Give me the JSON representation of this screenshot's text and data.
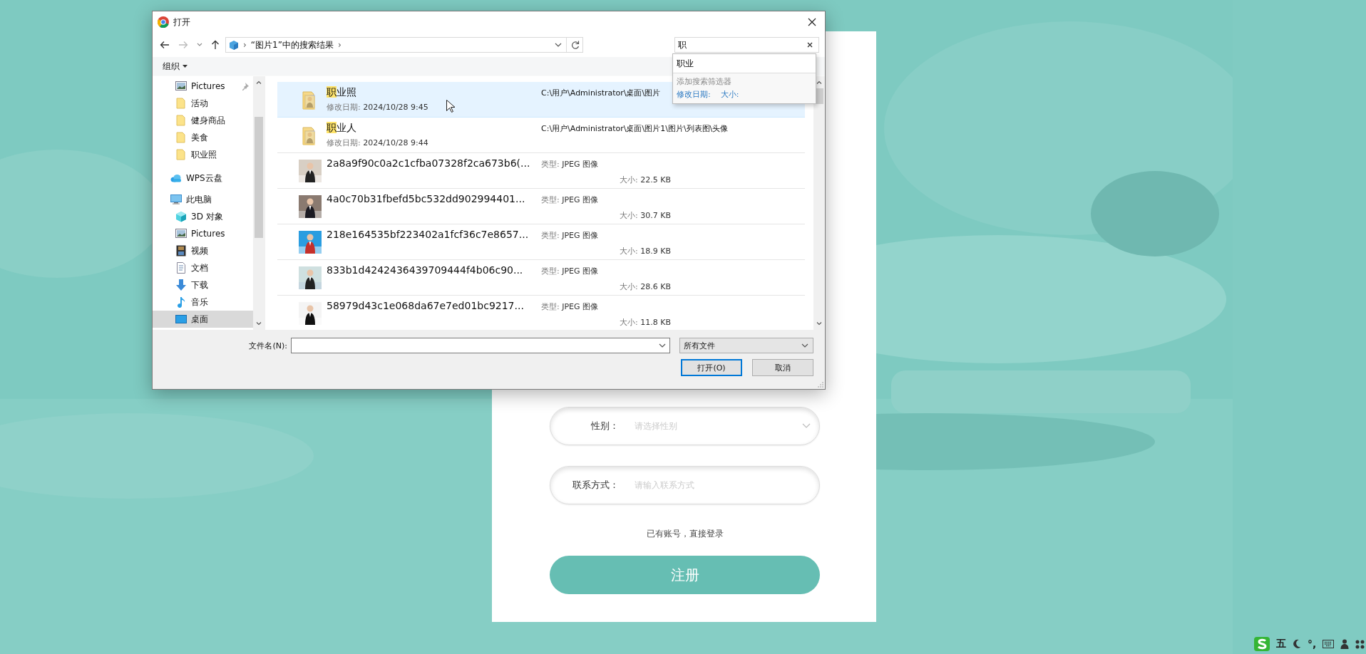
{
  "dialog": {
    "title": "打开",
    "address": [
      {
        "kind": "separator",
        "text": "›"
      },
      {
        "kind": "crumb",
        "text": "“图片1”中的搜索结果"
      },
      {
        "kind": "separator",
        "text": "›"
      }
    ],
    "search": {
      "value": "职"
    },
    "suggestions": {
      "items": [
        "职业"
      ],
      "filter_heading": "添加搜索筛选器",
      "filters": [
        "修改日期:",
        "大小:"
      ]
    },
    "toolbar": {
      "organize": "组织"
    },
    "nav_pane": {
      "quick_access": [
        {
          "label": "Pictures",
          "kind": "pictures",
          "pinned": true,
          "selected": false
        },
        {
          "label": "活动",
          "kind": "folder",
          "pinned": false,
          "selected": false
        },
        {
          "label": "健身商品",
          "kind": "folder",
          "pinned": false,
          "selected": false
        },
        {
          "label": "美食",
          "kind": "folder",
          "pinned": false,
          "selected": false
        },
        {
          "label": "职业照",
          "kind": "folder",
          "pinned": false,
          "selected": false
        }
      ],
      "items": [
        {
          "label": "WPS云盘",
          "kind": "cloud",
          "selected": false
        },
        {
          "label": "此电脑",
          "kind": "pc",
          "selected": false,
          "children": [
            {
              "label": "3D 对象",
              "kind": "cube",
              "selected": false
            },
            {
              "label": "Pictures",
              "kind": "pictures",
              "selected": false
            },
            {
              "label": "视频",
              "kind": "video",
              "selected": false
            },
            {
              "label": "文档",
              "kind": "document",
              "selected": false
            },
            {
              "label": "下载",
              "kind": "download",
              "selected": false
            },
            {
              "label": "音乐",
              "kind": "music",
              "selected": false
            },
            {
              "label": "桌面",
              "kind": "desktop",
              "selected": true
            }
          ]
        }
      ]
    },
    "results": [
      {
        "kind": "folder",
        "selected": true,
        "name_parts": [
          {
            "text": "职",
            "highlighted": true
          },
          {
            "text": "业照",
            "highlighted": false
          }
        ],
        "date_label": "修改日期:",
        "date": "2024/10/28 9:45",
        "path": "C:\\用户\\Administrator\\桌面\\图片"
      },
      {
        "kind": "folder",
        "selected": false,
        "name_parts": [
          {
            "text": "职",
            "highlighted": true
          },
          {
            "text": "业人",
            "highlighted": false
          }
        ],
        "date_label": "修改日期:",
        "date": "2024/10/28 9:44",
        "path": "C:\\用户\\Administrator\\桌面\\图片1\\图片\\列表图\\头像"
      },
      {
        "selected": false,
        "name": "2a8a9f90c0a2c1cfba07328f2ca673b6(...",
        "type_label": "类型:",
        "type": "JPEG 图像",
        "size_label": "大小:",
        "size": "22.5 KB"
      },
      {
        "selected": false,
        "name": "4a0c70b31fbefd5bc532dd902994401...",
        "type_label": "类型:",
        "type": "JPEG 图像",
        "size_label": "大小:",
        "size": "30.7 KB"
      },
      {
        "selected": false,
        "name": "218e164535bf223402a1fcf36c7e8657...",
        "type_label": "类型:",
        "type": "JPEG 图像",
        "size_label": "大小:",
        "size": "18.9 KB"
      },
      {
        "selected": false,
        "name": "833b1d4242436439709444f4b06c90...",
        "type_label": "类型:",
        "type": "JPEG 图像",
        "size_label": "大小:",
        "size": "28.6 KB"
      },
      {
        "selected": false,
        "name": "58979d43c1e068da67e7ed01bc9217...",
        "type_label": "类型:",
        "type": "JPEG 图像",
        "size_label": "大小:",
        "size": "11.8 KB"
      }
    ],
    "file_name": {
      "label": "文件名(N):"
    },
    "file_type": "所有文件",
    "buttons": [
      {
        "label": "打开(O)",
        "kind": "primary"
      },
      {
        "label": "取消",
        "kind": "secondary"
      }
    ]
  },
  "form": {
    "fields": [
      {
        "label": "性别：",
        "placeholder": "请选择性别",
        "kind": "select"
      },
      {
        "label": "联系方式：",
        "placeholder": "请输入联系方式",
        "kind": "input"
      }
    ],
    "login_link": "已有账号，直接登录",
    "submit": "注册"
  },
  "ime_bar": {
    "items": [
      {
        "kind": "logo"
      },
      {
        "kind": "text",
        "text": "五"
      },
      {
        "kind": "moon"
      },
      {
        "kind": "text",
        "text": "°,"
      },
      {
        "kind": "keyboard"
      },
      {
        "kind": "user"
      },
      {
        "kind": "grid"
      }
    ]
  }
}
